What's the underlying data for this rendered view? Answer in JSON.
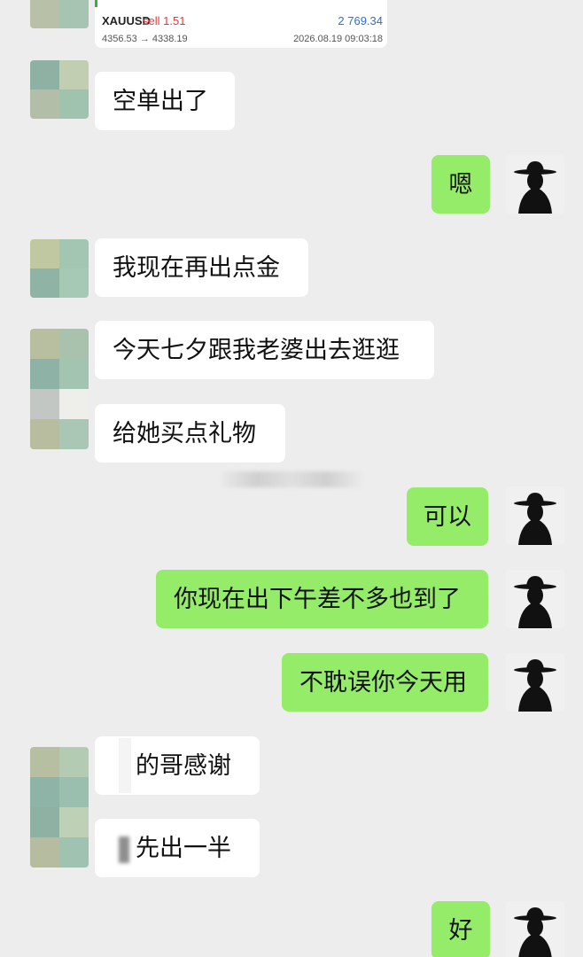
{
  "trade_card": {
    "symbol": "XAUUSD",
    "side": "sell 1.51",
    "profit": "2 769.34",
    "price_range": "4356.53 → 4338.19",
    "close_time": "2026.08.19 09:03:18",
    "colors": {
      "sell": "#e03b3b",
      "profit": "#2b6fcf",
      "accent": "#2db24d"
    }
  },
  "messages": [
    {
      "from": "other",
      "text": "空单出了"
    },
    {
      "from": "me",
      "text": "嗯"
    },
    {
      "from": "other",
      "text": "我现在再出点金"
    },
    {
      "from": "other",
      "text": "今天七夕跟我老婆出去逛逛"
    },
    {
      "from": "other",
      "text": "给她买点礼物"
    },
    {
      "from": "me",
      "text": "可以"
    },
    {
      "from": "me",
      "text": "你现在出下午差不多也到了"
    },
    {
      "from": "me",
      "text": "不耽误你今天用"
    },
    {
      "from": "other",
      "text": "的哥感谢"
    },
    {
      "from": "other",
      "text": "先出一半"
    },
    {
      "from": "me",
      "text": "好"
    }
  ],
  "colors": {
    "background": "#ededed",
    "my_bubble": "#95ec69",
    "other_bubble": "#ffffff"
  },
  "icons": {
    "my_avatar": "silhouette-hat-avatar-icon",
    "other_avatar": "mosaic-avatar-icon"
  }
}
